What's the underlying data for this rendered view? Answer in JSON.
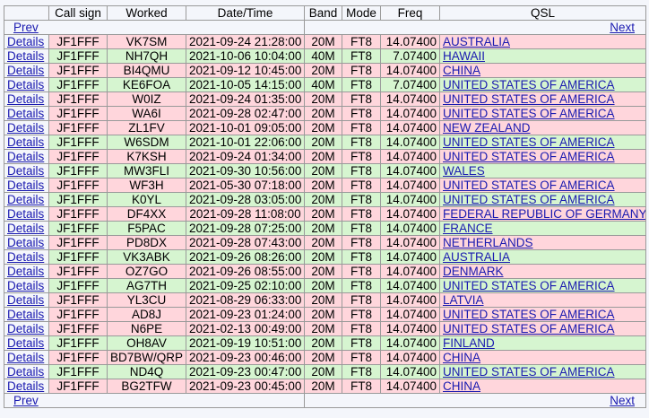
{
  "nav": {
    "prev": "Prev",
    "next": "Next"
  },
  "headers": [
    "",
    "Call sign",
    "Worked",
    "Date/Time",
    "Band",
    "Mode",
    "Freq",
    "QSL"
  ],
  "colors": {
    "confirmed": "#d6f5d0",
    "unconfirmed": "#ffd6dc"
  },
  "rows": [
    {
      "details": "Details",
      "call": "JF1FFF",
      "worked": "VK7SM",
      "datetime": "2021-09-24 21:28:00",
      "band": "20M",
      "mode": "FT8",
      "freq": "14.07400",
      "qsl": "AUSTRALIA",
      "status": "pink"
    },
    {
      "details": "Details",
      "call": "JF1FFF",
      "worked": "NH7QH",
      "datetime": "2021-10-06 10:04:00",
      "band": "40M",
      "mode": "FT8",
      "freq": "7.07400",
      "qsl": "HAWAII",
      "status": "green"
    },
    {
      "details": "Details",
      "call": "JF1FFF",
      "worked": "BI4QMU",
      "datetime": "2021-09-12 10:45:00",
      "band": "20M",
      "mode": "FT8",
      "freq": "14.07400",
      "qsl": "CHINA",
      "status": "pink"
    },
    {
      "details": "Details",
      "call": "JF1FFF",
      "worked": "KE6FOA",
      "datetime": "2021-10-05 14:15:00",
      "band": "40M",
      "mode": "FT8",
      "freq": "7.07400",
      "qsl": "UNITED STATES OF AMERICA",
      "status": "green"
    },
    {
      "details": "Details",
      "call": "JF1FFF",
      "worked": "W0IZ",
      "datetime": "2021-09-24 01:35:00",
      "band": "20M",
      "mode": "FT8",
      "freq": "14.07400",
      "qsl": "UNITED STATES OF AMERICA",
      "status": "pink"
    },
    {
      "details": "Details",
      "call": "JF1FFF",
      "worked": "WA6I",
      "datetime": "2021-09-28 02:47:00",
      "band": "20M",
      "mode": "FT8",
      "freq": "14.07400",
      "qsl": "UNITED STATES OF AMERICA",
      "status": "pink"
    },
    {
      "details": "Details",
      "call": "JF1FFF",
      "worked": "ZL1FV",
      "datetime": "2021-10-01 09:05:00",
      "band": "20M",
      "mode": "FT8",
      "freq": "14.07400",
      "qsl": "NEW ZEALAND",
      "status": "pink"
    },
    {
      "details": "Details",
      "call": "JF1FFF",
      "worked": "W6SDM",
      "datetime": "2021-10-01 22:06:00",
      "band": "20M",
      "mode": "FT8",
      "freq": "14.07400",
      "qsl": "UNITED STATES OF AMERICA",
      "status": "green"
    },
    {
      "details": "Details",
      "call": "JF1FFF",
      "worked": "K7KSH",
      "datetime": "2021-09-24 01:34:00",
      "band": "20M",
      "mode": "FT8",
      "freq": "14.07400",
      "qsl": "UNITED STATES OF AMERICA",
      "status": "pink"
    },
    {
      "details": "Details",
      "call": "JF1FFF",
      "worked": "MW3FLI",
      "datetime": "2021-09-30 10:56:00",
      "band": "20M",
      "mode": "FT8",
      "freq": "14.07400",
      "qsl": "WALES",
      "status": "green"
    },
    {
      "details": "Details",
      "call": "JF1FFF",
      "worked": "WF3H",
      "datetime": "2021-05-30 07:18:00",
      "band": "20M",
      "mode": "FT8",
      "freq": "14.07400",
      "qsl": "UNITED STATES OF AMERICA",
      "status": "pink"
    },
    {
      "details": "Details",
      "call": "JF1FFF",
      "worked": "K0YL",
      "datetime": "2021-09-28 03:05:00",
      "band": "20M",
      "mode": "FT8",
      "freq": "14.07400",
      "qsl": "UNITED STATES OF AMERICA",
      "status": "green"
    },
    {
      "details": "Details",
      "call": "JF1FFF",
      "worked": "DF4XX",
      "datetime": "2021-09-28 11:08:00",
      "band": "20M",
      "mode": "FT8",
      "freq": "14.07400",
      "qsl": "FEDERAL REPUBLIC OF GERMANY",
      "status": "pink"
    },
    {
      "details": "Details",
      "call": "JF1FFF",
      "worked": "F5PAC",
      "datetime": "2021-09-28 07:25:00",
      "band": "20M",
      "mode": "FT8",
      "freq": "14.07400",
      "qsl": "FRANCE",
      "status": "green"
    },
    {
      "details": "Details",
      "call": "JF1FFF",
      "worked": "PD8DX",
      "datetime": "2021-09-28 07:43:00",
      "band": "20M",
      "mode": "FT8",
      "freq": "14.07400",
      "qsl": "NETHERLANDS",
      "status": "pink"
    },
    {
      "details": "Details",
      "call": "JF1FFF",
      "worked": "VK3ABK",
      "datetime": "2021-09-26 08:26:00",
      "band": "20M",
      "mode": "FT8",
      "freq": "14.07400",
      "qsl": "AUSTRALIA",
      "status": "green"
    },
    {
      "details": "Details",
      "call": "JF1FFF",
      "worked": "OZ7GO",
      "datetime": "2021-09-26 08:55:00",
      "band": "20M",
      "mode": "FT8",
      "freq": "14.07400",
      "qsl": "DENMARK",
      "status": "pink"
    },
    {
      "details": "Details",
      "call": "JF1FFF",
      "worked": "AG7TH",
      "datetime": "2021-09-25 02:10:00",
      "band": "20M",
      "mode": "FT8",
      "freq": "14.07400",
      "qsl": "UNITED STATES OF AMERICA",
      "status": "green"
    },
    {
      "details": "Details",
      "call": "JF1FFF",
      "worked": "YL3CU",
      "datetime": "2021-08-29 06:33:00",
      "band": "20M",
      "mode": "FT8",
      "freq": "14.07400",
      "qsl": "LATVIA",
      "status": "pink"
    },
    {
      "details": "Details",
      "call": "JF1FFF",
      "worked": "AD8J",
      "datetime": "2021-09-23 01:24:00",
      "band": "20M",
      "mode": "FT8",
      "freq": "14.07400",
      "qsl": "UNITED STATES OF AMERICA",
      "status": "pink"
    },
    {
      "details": "Details",
      "call": "JF1FFF",
      "worked": "N6PE",
      "datetime": "2021-02-13 00:49:00",
      "band": "20M",
      "mode": "FT8",
      "freq": "14.07400",
      "qsl": "UNITED STATES OF AMERICA",
      "status": "pink"
    },
    {
      "details": "Details",
      "call": "JF1FFF",
      "worked": "OH8AV",
      "datetime": "2021-09-19 10:51:00",
      "band": "20M",
      "mode": "FT8",
      "freq": "14.07400",
      "qsl": "FINLAND",
      "status": "green"
    },
    {
      "details": "Details",
      "call": "JF1FFF",
      "worked": "BD7BW/QRP",
      "datetime": "2021-09-23 00:46:00",
      "band": "20M",
      "mode": "FT8",
      "freq": "14.07400",
      "qsl": "CHINA",
      "status": "pink"
    },
    {
      "details": "Details",
      "call": "JF1FFF",
      "worked": "ND4Q",
      "datetime": "2021-09-23 00:47:00",
      "band": "20M",
      "mode": "FT8",
      "freq": "14.07400",
      "qsl": "UNITED STATES OF AMERICA",
      "status": "green"
    },
    {
      "details": "Details",
      "call": "JF1FFF",
      "worked": "BG2TFW",
      "datetime": "2021-09-23 00:45:00",
      "band": "20M",
      "mode": "FT8",
      "freq": "14.07400",
      "qsl": "CHINA",
      "status": "pink"
    }
  ]
}
